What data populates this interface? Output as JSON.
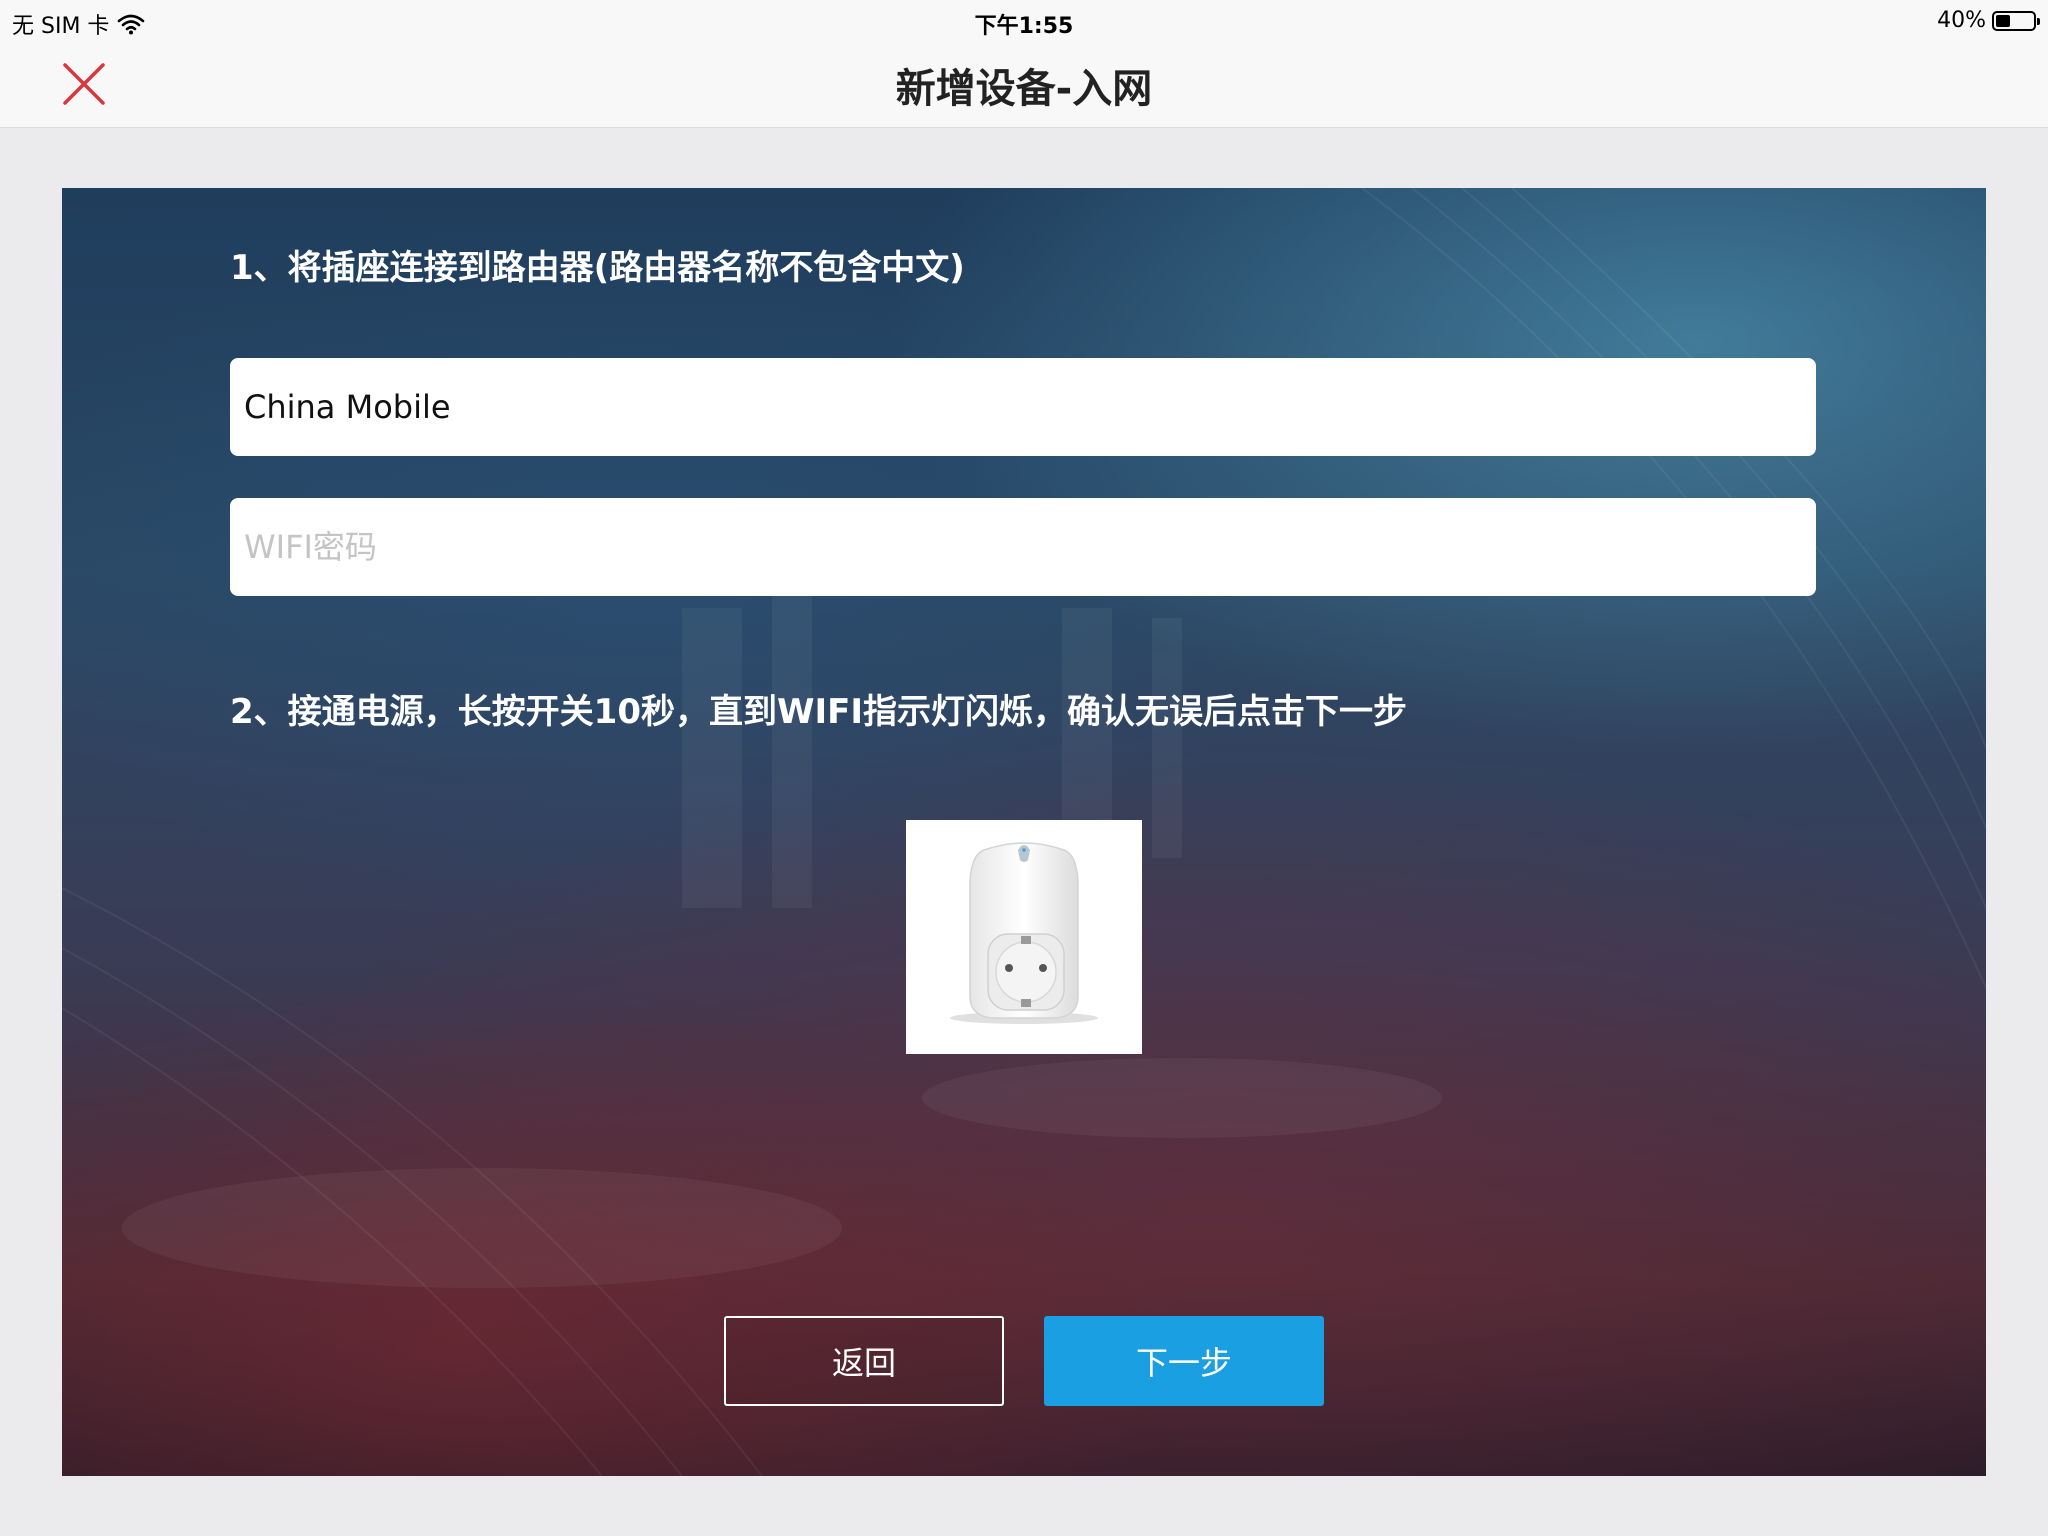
{
  "status_bar": {
    "carrier": "无 SIM 卡",
    "time": "下午1:55",
    "battery_percent_text": "40%",
    "battery_level": 0.4
  },
  "nav": {
    "title": "新增设备-入网",
    "close_icon": "close-icon",
    "close_color": "#d9363e"
  },
  "form": {
    "step1_text": "1、将插座连接到路由器(路由器名称不包含中文)",
    "ssid_value": "China Mobile",
    "password_value": "",
    "password_placeholder": "WIFI密码",
    "step2_text": "2、接通电源，长按开关10秒，直到WIFI指示灯闪烁，确认无误后点击下一步",
    "device_image_icon": "smart-plug-icon"
  },
  "actions": {
    "back_label": "返回",
    "next_label": "下一步",
    "next_color": "#1a9fe3"
  }
}
